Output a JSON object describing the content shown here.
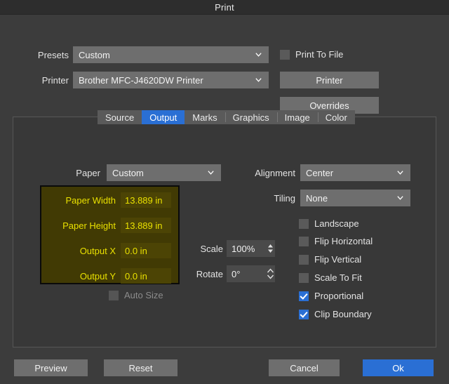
{
  "window": {
    "title": "Print"
  },
  "top": {
    "presets_label": "Presets",
    "presets_value": "Custom",
    "printer_label": "Printer",
    "printer_value": "Brother MFC-J4620DW Printer",
    "print_to_file_label": "Print To File",
    "print_to_file_checked": false,
    "printer_button": "Printer",
    "overrides_button": "Overrides"
  },
  "tabs": [
    {
      "label": "Source",
      "active": false
    },
    {
      "label": "Output",
      "active": true
    },
    {
      "label": "Marks",
      "active": false
    },
    {
      "label": "Graphics",
      "active": false
    },
    {
      "label": "Image",
      "active": false
    },
    {
      "label": "Color",
      "active": false
    }
  ],
  "output": {
    "paper_label": "Paper",
    "paper_value": "Custom",
    "highlight_rows": [
      {
        "label": "Paper Width",
        "value": "13.889 in"
      },
      {
        "label": "Paper Height",
        "value": "13.889 in"
      },
      {
        "label": "Output X",
        "value": "0.0 in"
      },
      {
        "label": "Output Y",
        "value": "0.0 in"
      }
    ],
    "auto_size_label": "Auto Size",
    "auto_size_checked": false,
    "auto_size_disabled": true,
    "scale_label": "Scale",
    "scale_value": "100%",
    "rotate_label": "Rotate",
    "rotate_value": "0°",
    "alignment_label": "Alignment",
    "alignment_value": "Center",
    "tiling_label": "Tiling",
    "tiling_value": "None",
    "checkboxes": [
      {
        "label": "Landscape",
        "checked": false
      },
      {
        "label": "Flip Horizontal",
        "checked": false
      },
      {
        "label": "Flip Vertical",
        "checked": false
      },
      {
        "label": "Scale To Fit",
        "checked": false
      },
      {
        "label": "Proportional",
        "checked": true
      },
      {
        "label": "Clip Boundary",
        "checked": true
      }
    ]
  },
  "footer": {
    "preview": "Preview",
    "reset": "Reset",
    "cancel": "Cancel",
    "ok": "Ok"
  },
  "colors": {
    "accent": "#2a6fd4",
    "window_bg": "#3c3c3c",
    "titlebar_bg": "#2d2d2d",
    "panel_bg": "#383838",
    "control_bg": "#6e6e6e",
    "highlight_box_bg": "#413a04",
    "highlight_text": "#e9e000"
  }
}
